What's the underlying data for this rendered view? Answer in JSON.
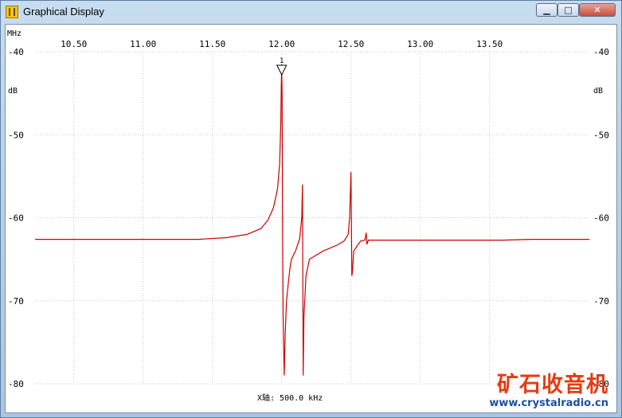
{
  "window": {
    "title": "Graphical Display",
    "app_icon": "filter-icon",
    "controls": [
      "minimize-icon",
      "maximize-icon",
      "close-icon"
    ]
  },
  "colors": {
    "trace": "#cc0000",
    "grid": "#c8c8c8",
    "background": "#ffffff"
  },
  "plot": {
    "x_unit_label": "MHz",
    "y_unit_label": "dB",
    "x_axis_caption": "X轴: 500.0 kHz"
  },
  "marker": {
    "label": "1",
    "x": 12.0
  },
  "watermark": {
    "cn": "矿石收音机",
    "url": "www.crystalradio.cn"
  },
  "chart_data": {
    "type": "line",
    "xlim": [
      10.22,
      14.22
    ],
    "ylim": [
      -80,
      -40
    ],
    "x_ticks": [
      10.5,
      11.0,
      11.5,
      12.0,
      12.5,
      13.0,
      13.5
    ],
    "x_tick_labels": [
      "10.50",
      "11.00",
      "11.50",
      "12.00",
      "12.50",
      "13.00",
      "13.50"
    ],
    "y_ticks": [
      -40,
      -50,
      -60,
      -70,
      -80
    ],
    "y_tick_labels": [
      "-40",
      "-50",
      "-60",
      "-70",
      "-80"
    ],
    "grid": true,
    "series": [
      {
        "x": [
          10.22,
          10.4,
          10.6,
          10.8,
          11.0,
          11.2,
          11.4,
          11.6,
          11.75,
          11.85,
          11.9,
          11.94,
          11.97,
          11.985,
          11.993,
          11.997,
          12.0,
          12.003,
          12.006,
          12.01,
          12.018,
          12.025,
          12.035,
          12.05,
          12.06,
          12.07,
          12.1,
          12.13,
          12.145,
          12.15,
          12.155,
          12.16,
          12.175,
          12.2,
          12.3,
          12.4,
          12.45,
          12.48,
          12.49,
          12.497,
          12.5,
          12.503,
          12.506,
          12.51,
          12.52,
          12.54,
          12.57,
          12.6,
          12.61,
          12.615,
          12.625,
          12.65,
          12.7,
          12.8,
          13.0,
          13.2,
          13.4,
          13.6,
          13.8,
          14.0,
          14.22
        ],
        "y": [
          -62.6,
          -62.6,
          -62.6,
          -62.6,
          -62.6,
          -62.6,
          -62.6,
          -62.4,
          -62.0,
          -61.3,
          -60.3,
          -58.8,
          -56.5,
          -53.5,
          -49.0,
          -44.0,
          -41.5,
          -45.0,
          -60.0,
          -72.0,
          -79.0,
          -74.0,
          -70.0,
          -67.5,
          -66.0,
          -65.0,
          -64.0,
          -62.5,
          -60.0,
          -56.0,
          -79.0,
          -72.0,
          -67.0,
          -65.0,
          -64.0,
          -63.3,
          -62.8,
          -62.0,
          -60.0,
          -56.0,
          -54.5,
          -60.0,
          -67.0,
          -66.5,
          -64.0,
          -63.5,
          -62.8,
          -62.7,
          -61.8,
          -63.2,
          -62.7,
          -62.7,
          -62.7,
          -62.7,
          -62.7,
          -62.7,
          -62.7,
          -62.7,
          -62.6,
          -62.6,
          -62.6
        ]
      }
    ]
  }
}
